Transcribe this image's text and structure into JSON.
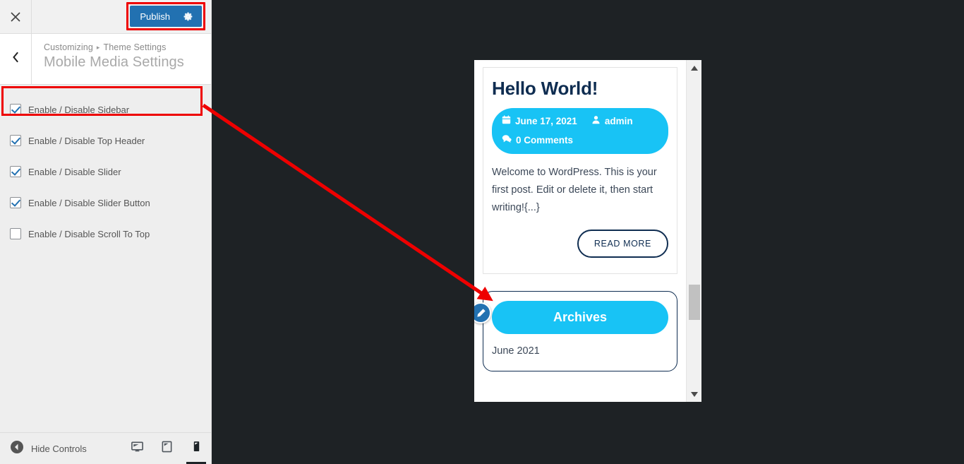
{
  "header": {
    "close_icon": "close-icon",
    "publish_label": "Publish",
    "gear_icon": "gear-icon"
  },
  "panel": {
    "back_icon": "chevron-left-icon",
    "breadcrumb_root": "Customizing",
    "breadcrumb_separator": "▸",
    "breadcrumb_parent": "Theme Settings",
    "section_title": "Mobile Media Settings"
  },
  "controls": [
    {
      "label": "Enable / Disable Sidebar",
      "checked": true,
      "highlighted": true
    },
    {
      "label": "Enable / Disable Top Header",
      "checked": true,
      "highlighted": false
    },
    {
      "label": "Enable / Disable Slider",
      "checked": true,
      "highlighted": false
    },
    {
      "label": "Enable / Disable Slider Button",
      "checked": true,
      "highlighted": false
    },
    {
      "label": "Enable / Disable Scroll To Top",
      "checked": false,
      "highlighted": false
    }
  ],
  "footer": {
    "hide_controls_label": "Hide Controls",
    "collapse_icon": "collapse-left-icon",
    "devices": [
      {
        "name": "desktop",
        "icon": "desktop-icon",
        "active": false
      },
      {
        "name": "tablet",
        "icon": "tablet-icon",
        "active": false
      },
      {
        "name": "mobile",
        "icon": "mobile-icon",
        "active": true
      }
    ]
  },
  "preview": {
    "device": "mobile",
    "post": {
      "title": "Hello World!",
      "meta": {
        "date_icon": "calendar-icon",
        "date": "June 17, 2021",
        "author_icon": "user-icon",
        "author": "admin",
        "comments_icon": "comments-icon",
        "comments": "0 Comments"
      },
      "excerpt": "Welcome to WordPress. This is your first post. Edit or delete it, then start writing!{...}",
      "read_more_label": "READ MORE"
    },
    "widget": {
      "edit_icon": "pencil-edit-icon",
      "title": "Archives",
      "items": [
        "June 2021"
      ]
    },
    "scrollbar": {
      "up_icon": "scroll-up-arrow-icon",
      "down_icon": "scroll-down-arrow-icon"
    }
  },
  "annotations": {
    "highlight_color": "#ee0000",
    "arrow_color": "#ee0000"
  },
  "colors": {
    "accent_cyan": "#18c3f5",
    "navy": "#0f2d51",
    "wp_blue": "#2271b1",
    "stage_dark": "#1e2225"
  }
}
